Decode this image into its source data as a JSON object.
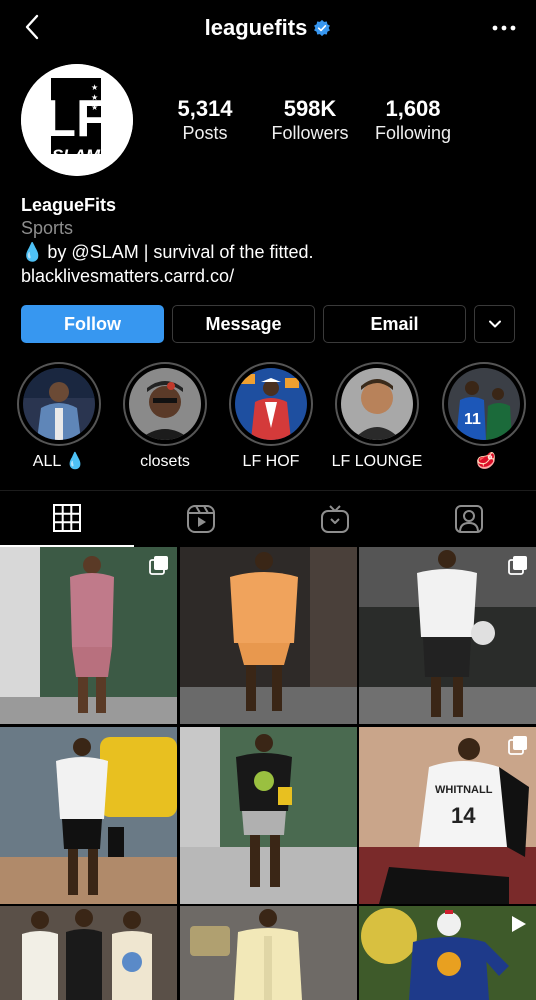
{
  "header": {
    "username": "leaguefits",
    "verified": true,
    "back_icon": "chevron-left-icon",
    "more_icon": "ellipsis-icon"
  },
  "profile": {
    "avatar_text_top": "LF",
    "avatar_text_bottom": "SLAM",
    "stats": {
      "posts_value": "5,314",
      "posts_label": "Posts",
      "followers_value": "598K",
      "followers_label": "Followers",
      "following_value": "1,608",
      "following_label": "Following"
    },
    "name": "LeagueFits",
    "category": "Sports",
    "bio_emoji": "💧",
    "bio_text": "by @SLAM | survival of the fitted.",
    "link": "blacklivesmatters.carrd.co/"
  },
  "actions": {
    "follow": "Follow",
    "message": "Message",
    "email": "Email",
    "more_icon": "chevron-down-icon"
  },
  "highlights": [
    {
      "label": "ALL",
      "emoji": "💧"
    },
    {
      "label": "closets",
      "emoji": ""
    },
    {
      "label": "LF HOF",
      "emoji": ""
    },
    {
      "label": "LF LOUNGE",
      "emoji": ""
    },
    {
      "label": "",
      "emoji": "🥩"
    }
  ],
  "tabs": [
    {
      "icon": "grid-icon",
      "active": true
    },
    {
      "icon": "reels-icon",
      "active": false
    },
    {
      "icon": "igtv-icon",
      "active": false
    },
    {
      "icon": "tagged-icon",
      "active": false
    }
  ],
  "colors": {
    "accent": "#3797f0",
    "verified": "#3897f0",
    "background": "#000000"
  }
}
